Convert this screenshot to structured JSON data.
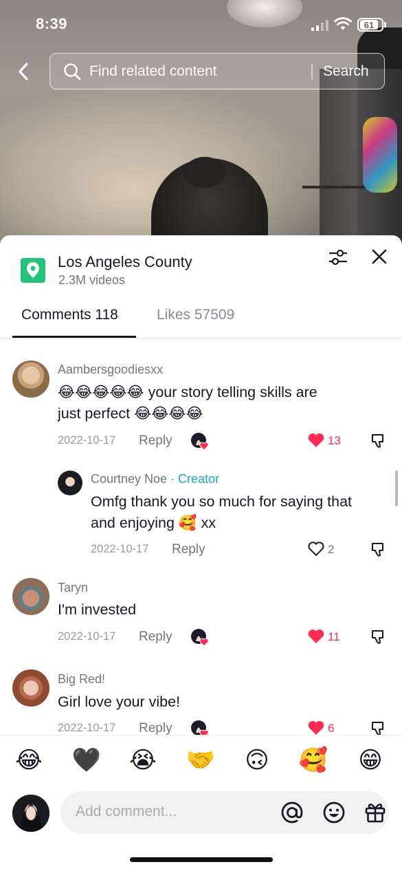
{
  "status_bar": {
    "time": "8:39",
    "battery": "61"
  },
  "search": {
    "placeholder": "Find related content",
    "button": "Search"
  },
  "location": {
    "title": "Los Angeles County",
    "subtitle": "2.3M videos"
  },
  "tabs": {
    "comments": "Comments 118",
    "likes": "Likes 57509"
  },
  "comments": [
    {
      "username": "Aambersgoodiesxx",
      "text_line1": "😂😂😂😂😂 your story telling skills are",
      "text_line2": "just perfect 😂😂😂😂",
      "date": "2022-10-17",
      "reply": "Reply",
      "likes": "13",
      "liked": true
    },
    {
      "username": "Courtney Noe",
      "creator_tag": " · Creator",
      "text_line1": "Omfg thank you so much for saying that",
      "text_line2": "and enjoying 🥰 xx",
      "date": "2022-10-17",
      "reply": "Reply",
      "likes": "2",
      "liked": false
    },
    {
      "username": "Taryn",
      "text_line1": "I'm invested",
      "date": "2022-10-17",
      "reply": "Reply",
      "likes": "11",
      "liked": true
    },
    {
      "username": "Big Red!",
      "text_line1": "Girl love your vibe!",
      "date": "2022-10-17",
      "reply": "Reply",
      "likes": "6",
      "liked": true
    }
  ],
  "quick_emojis": [
    "😂",
    "🖤",
    "😭",
    "🤝",
    "🙃",
    "🥰",
    "😁"
  ],
  "composer": {
    "placeholder": "Add comment..."
  },
  "colors": {
    "like_red": "#fe2c55",
    "creator_blue": "#20a5c4",
    "location_green": "#25c27d"
  }
}
